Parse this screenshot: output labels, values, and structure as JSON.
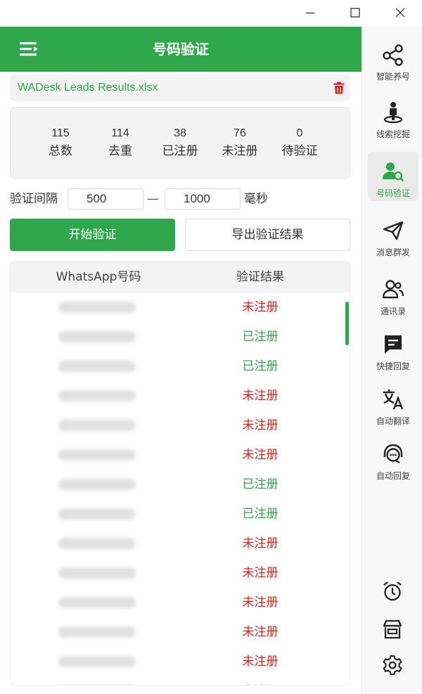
{
  "app": {
    "title": "号码验证",
    "colors": {
      "accent": "#2ea84a",
      "unregistered": "#e3201b",
      "registered": "#2ea84a"
    }
  },
  "file": {
    "name": "WADesk Leads Results.xlsx"
  },
  "stats": [
    {
      "value": "115",
      "label": "总数"
    },
    {
      "value": "114",
      "label": "去重"
    },
    {
      "value": "38",
      "label": "已注册"
    },
    {
      "value": "76",
      "label": "未注册"
    },
    {
      "value": "0",
      "label": "待验证"
    }
  ],
  "interval": {
    "label": "验证间隔",
    "min": "500",
    "dash": "—",
    "max": "1000",
    "unit": "毫秒"
  },
  "buttons": {
    "start": "开始验证",
    "export": "导出验证结果"
  },
  "table": {
    "columns": [
      "WhatsApp号码",
      "验证结果"
    ],
    "rows": [
      {
        "result": "未注册",
        "status": "unregistered"
      },
      {
        "result": "已注册",
        "status": "registered"
      },
      {
        "result": "已注册",
        "status": "registered"
      },
      {
        "result": "未注册",
        "status": "unregistered"
      },
      {
        "result": "未注册",
        "status": "unregistered"
      },
      {
        "result": "未注册",
        "status": "unregistered"
      },
      {
        "result": "已注册",
        "status": "registered"
      },
      {
        "result": "已注册",
        "status": "registered"
      },
      {
        "result": "未注册",
        "status": "unregistered"
      },
      {
        "result": "未注册",
        "status": "unregistered"
      },
      {
        "result": "未注册",
        "status": "unregistered"
      },
      {
        "result": "未注册",
        "status": "unregistered"
      },
      {
        "result": "未注册",
        "status": "unregistered"
      },
      {
        "result": "未注册",
        "status": "unregistered"
      }
    ]
  },
  "sidebar": {
    "items": [
      {
        "label": "智能养号",
        "icon": "share-nodes-icon"
      },
      {
        "label": "线索挖掘",
        "icon": "person-location-icon"
      },
      {
        "label": "号码验证",
        "icon": "user-search-icon",
        "active": true
      },
      {
        "label": "消息群发",
        "icon": "paper-plane-icon"
      },
      {
        "label": "通讯录",
        "icon": "contacts-icon"
      },
      {
        "label": "快捷回复",
        "icon": "message-box-icon"
      },
      {
        "label": "自动翻译",
        "icon": "translate-icon"
      },
      {
        "label": "自动回复",
        "icon": "headset-chat-icon"
      }
    ],
    "bottom": [
      "alarm-clock-icon",
      "store-icon",
      "gear-icon"
    ]
  }
}
